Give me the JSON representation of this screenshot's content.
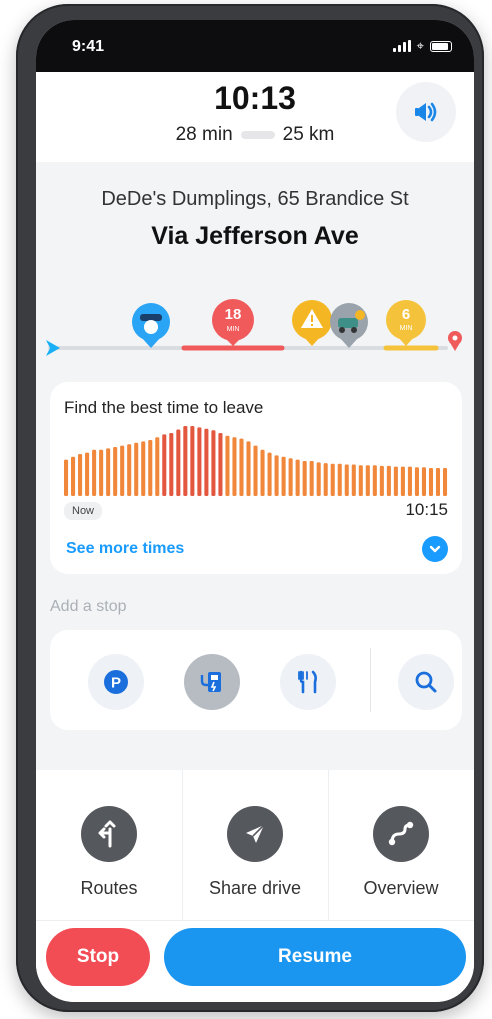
{
  "status": {
    "time": "9:41"
  },
  "header": {
    "eta": "10:13",
    "duration": "28 min",
    "distance": "25 km",
    "sound_icon": "speaker-icon"
  },
  "route": {
    "destination": "DeDe's Dumplings, 65 Brandice St",
    "via": "Via Jefferson Ave"
  },
  "timeline": {
    "markers": [
      {
        "icon": "police-icon",
        "color": "#2aa4f4"
      },
      {
        "label": "18",
        "sub": "MIN",
        "color": "#f05a5a"
      },
      {
        "icon": "hazard-icon",
        "color": "#f5b623"
      },
      {
        "icon": "crash-icon",
        "color": "#9aa3ab"
      },
      {
        "label": "6",
        "sub": "MIN",
        "color": "#f5c33b"
      }
    ]
  },
  "best_time": {
    "title": "Find the best time to leave",
    "now_label": "Now",
    "end_label": "10:15",
    "see_more": "See more times",
    "bar_levels": [
      0.52,
      0.56,
      0.6,
      0.62,
      0.66,
      0.66,
      0.68,
      0.7,
      0.72,
      0.74,
      0.76,
      0.78,
      0.8,
      0.84,
      0.88,
      0.9,
      0.95,
      1.0,
      1.0,
      0.98,
      0.96,
      0.94,
      0.9,
      0.86,
      0.84,
      0.82,
      0.78,
      0.72,
      0.66,
      0.62,
      0.58,
      0.56,
      0.54,
      0.52,
      0.5,
      0.5,
      0.48,
      0.47,
      0.46,
      0.46,
      0.45,
      0.45,
      0.44,
      0.44,
      0.44,
      0.43,
      0.43,
      0.42,
      0.42,
      0.42,
      0.41,
      0.41,
      0.4,
      0.4,
      0.4
    ],
    "bar_color": "#f0873a",
    "bar_peak_color": "#e4573f"
  },
  "add_stop": {
    "label": "Add a stop",
    "options": [
      {
        "name": "parking-icon"
      },
      {
        "name": "ev-charging-icon"
      },
      {
        "name": "restaurant-icon"
      },
      {
        "name": "search-icon"
      }
    ]
  },
  "actions": [
    {
      "label": "Routes",
      "icon": "routes-icon"
    },
    {
      "label": "Share drive",
      "icon": "share-icon"
    },
    {
      "label": "Overview",
      "icon": "overview-icon"
    }
  ],
  "buttons": {
    "stop": "Stop",
    "resume": "Resume"
  },
  "colors": {
    "blue": "#1a96f0",
    "red": "#f24c55"
  }
}
